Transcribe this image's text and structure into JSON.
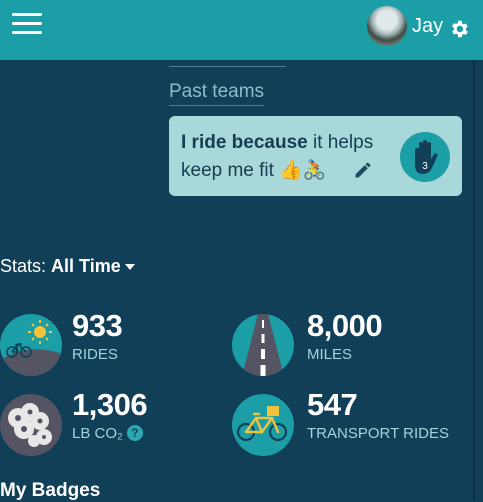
{
  "header": {
    "user_name": "Jay"
  },
  "teams": {
    "past_teams_label": "Past teams"
  },
  "ride_card": {
    "lead": "I ride because",
    "text": " it helps keep me fit 👍🚴",
    "badge_count": "3"
  },
  "stats": {
    "label": "Stats:",
    "period": "All Time",
    "items": [
      {
        "value": "933",
        "label": "RIDES"
      },
      {
        "value": "8,000",
        "label": "MILES"
      },
      {
        "value": "1,306",
        "label": "LB CO₂"
      },
      {
        "value": "547",
        "label": "TRANSPORT RIDES"
      }
    ],
    "help_label": "?"
  },
  "badges": {
    "title": "My Badges"
  },
  "colors": {
    "header": "#1b9ea5",
    "background": "#123f58",
    "card": "#a9d8da",
    "accent": "#1b9ea5"
  },
  "icons": [
    "menu-icon",
    "settings-gear-icon",
    "pencil-icon",
    "raised-hand-icon",
    "bike-sun-icon",
    "road-icon",
    "co2-cloud-icon",
    "cargo-bike-icon",
    "help-icon"
  ]
}
